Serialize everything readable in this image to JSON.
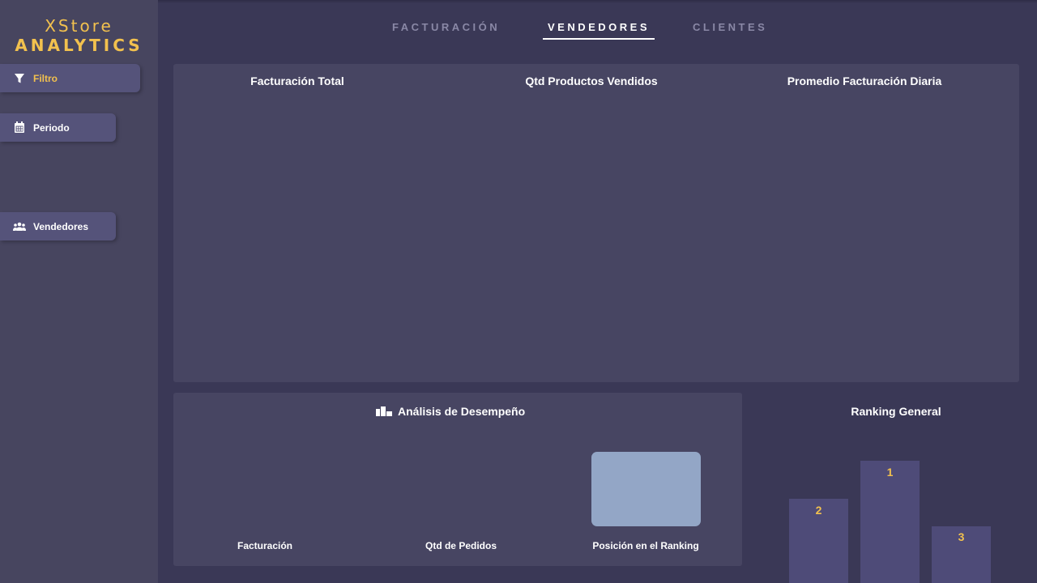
{
  "logo": {
    "top": "XStore",
    "bottom": "ANALYTICS"
  },
  "sidebar": {
    "filter_label": "Filtro",
    "period_label": "Periodo",
    "sellers_label": "Vendedores"
  },
  "tabs": [
    {
      "label": "FACTURACIÓN",
      "active": false
    },
    {
      "label": "VENDEDORES",
      "active": true
    },
    {
      "label": "CLIENTES",
      "active": false
    }
  ],
  "kpis": {
    "total_billing": "Facturación Total",
    "products_sold": "Qtd Productos Vendidos",
    "daily_avg": "Promedio Facturación Diaria"
  },
  "performance": {
    "title": "Análisis de Desempeño",
    "labels": [
      "Facturación",
      "Qtd de Pedidos",
      "Posición en el Ranking"
    ]
  },
  "ranking": {
    "title": "Ranking General",
    "positions": [
      "2",
      "1",
      "3"
    ]
  },
  "colors": {
    "accent": "#f2c14e",
    "background": "#3a3856",
    "panel": "#474562",
    "bar": "#4e4b78",
    "highlight_bar": "#93a6c6"
  }
}
